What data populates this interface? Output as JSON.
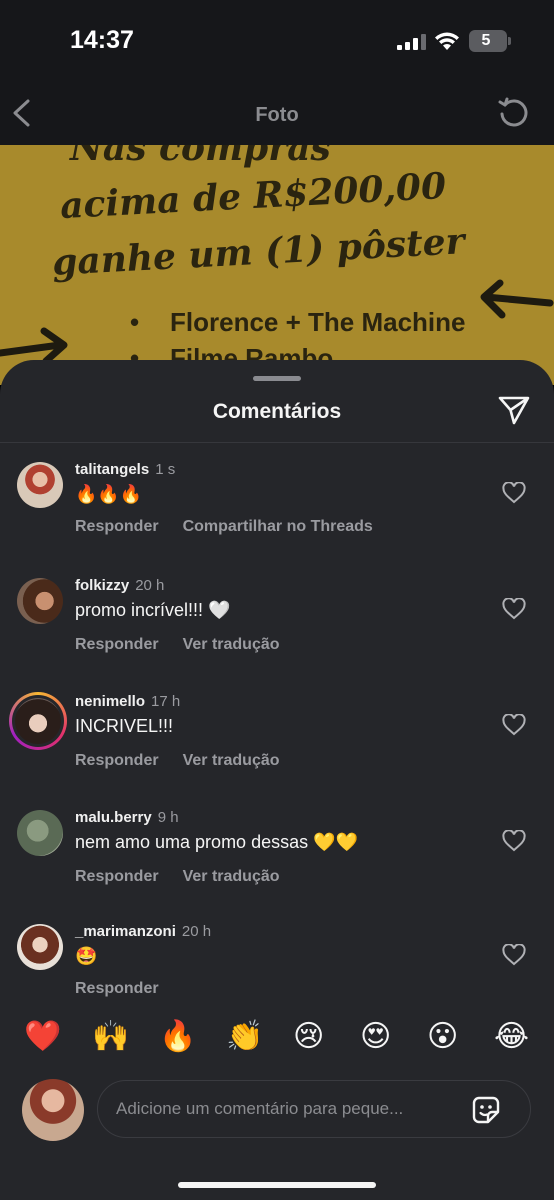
{
  "status_bar": {
    "time": "14:37",
    "battery": "5"
  },
  "header": {
    "title": "Foto"
  },
  "poster": {
    "line1": "Nas compras",
    "line2": "acima de R$200,00",
    "line3": "ganhe um (1) pôster",
    "bullets": [
      "Florence + The Machine",
      "Filme Rambo"
    ]
  },
  "sheet": {
    "title": "Comentários"
  },
  "comments": [
    {
      "username": "talitangels",
      "age": "1 s",
      "text": "🔥🔥🔥",
      "actions": [
        "Responder",
        "Compartilhar no Threads"
      ]
    },
    {
      "username": "folkizzy",
      "age": "20 h",
      "text": "promo incrível!!! 🤍",
      "actions": [
        "Responder",
        "Ver tradução"
      ]
    },
    {
      "username": "nenimello",
      "age": "17 h",
      "text": "INCRIVEL!!!",
      "actions": [
        "Responder",
        "Ver tradução"
      ]
    },
    {
      "username": "malu.berry",
      "age": "9 h",
      "text": "nem amo uma promo dessas 💛💛",
      "actions": [
        "Responder",
        "Ver tradução"
      ]
    },
    {
      "username": "_marimanzoni",
      "age": "20 h",
      "text": "🤩",
      "actions": [
        "Responder"
      ]
    }
  ],
  "emoji_reactions": [
    "❤️",
    "🙌",
    "🔥",
    "👏",
    "😢",
    "😍",
    "😮",
    "😂"
  ],
  "composer": {
    "placeholder": "Adicione um comentário para peque..."
  }
}
